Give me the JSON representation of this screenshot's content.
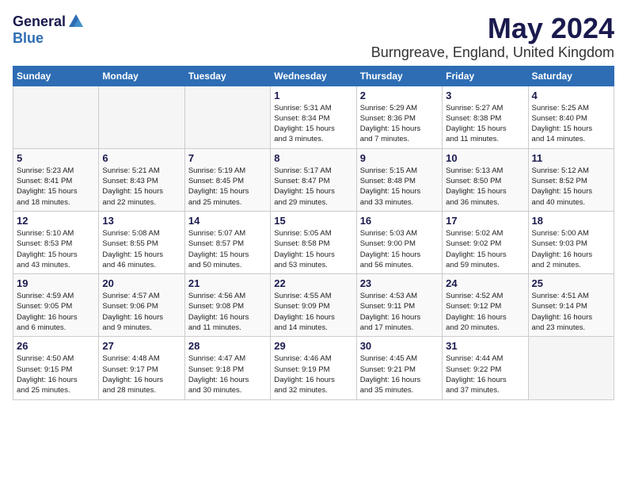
{
  "header": {
    "logo_general": "General",
    "logo_blue": "Blue",
    "title": "May 2024",
    "subtitle": "Burngreave, England, United Kingdom"
  },
  "weekdays": [
    "Sunday",
    "Monday",
    "Tuesday",
    "Wednesday",
    "Thursday",
    "Friday",
    "Saturday"
  ],
  "weeks": [
    [
      {
        "num": "",
        "info": ""
      },
      {
        "num": "",
        "info": ""
      },
      {
        "num": "",
        "info": ""
      },
      {
        "num": "1",
        "info": "Sunrise: 5:31 AM\nSunset: 8:34 PM\nDaylight: 15 hours\nand 3 minutes."
      },
      {
        "num": "2",
        "info": "Sunrise: 5:29 AM\nSunset: 8:36 PM\nDaylight: 15 hours\nand 7 minutes."
      },
      {
        "num": "3",
        "info": "Sunrise: 5:27 AM\nSunset: 8:38 PM\nDaylight: 15 hours\nand 11 minutes."
      },
      {
        "num": "4",
        "info": "Sunrise: 5:25 AM\nSunset: 8:40 PM\nDaylight: 15 hours\nand 14 minutes."
      }
    ],
    [
      {
        "num": "5",
        "info": "Sunrise: 5:23 AM\nSunset: 8:41 PM\nDaylight: 15 hours\nand 18 minutes."
      },
      {
        "num": "6",
        "info": "Sunrise: 5:21 AM\nSunset: 8:43 PM\nDaylight: 15 hours\nand 22 minutes."
      },
      {
        "num": "7",
        "info": "Sunrise: 5:19 AM\nSunset: 8:45 PM\nDaylight: 15 hours\nand 25 minutes."
      },
      {
        "num": "8",
        "info": "Sunrise: 5:17 AM\nSunset: 8:47 PM\nDaylight: 15 hours\nand 29 minutes."
      },
      {
        "num": "9",
        "info": "Sunrise: 5:15 AM\nSunset: 8:48 PM\nDaylight: 15 hours\nand 33 minutes."
      },
      {
        "num": "10",
        "info": "Sunrise: 5:13 AM\nSunset: 8:50 PM\nDaylight: 15 hours\nand 36 minutes."
      },
      {
        "num": "11",
        "info": "Sunrise: 5:12 AM\nSunset: 8:52 PM\nDaylight: 15 hours\nand 40 minutes."
      }
    ],
    [
      {
        "num": "12",
        "info": "Sunrise: 5:10 AM\nSunset: 8:53 PM\nDaylight: 15 hours\nand 43 minutes."
      },
      {
        "num": "13",
        "info": "Sunrise: 5:08 AM\nSunset: 8:55 PM\nDaylight: 15 hours\nand 46 minutes."
      },
      {
        "num": "14",
        "info": "Sunrise: 5:07 AM\nSunset: 8:57 PM\nDaylight: 15 hours\nand 50 minutes."
      },
      {
        "num": "15",
        "info": "Sunrise: 5:05 AM\nSunset: 8:58 PM\nDaylight: 15 hours\nand 53 minutes."
      },
      {
        "num": "16",
        "info": "Sunrise: 5:03 AM\nSunset: 9:00 PM\nDaylight: 15 hours\nand 56 minutes."
      },
      {
        "num": "17",
        "info": "Sunrise: 5:02 AM\nSunset: 9:02 PM\nDaylight: 15 hours\nand 59 minutes."
      },
      {
        "num": "18",
        "info": "Sunrise: 5:00 AM\nSunset: 9:03 PM\nDaylight: 16 hours\nand 2 minutes."
      }
    ],
    [
      {
        "num": "19",
        "info": "Sunrise: 4:59 AM\nSunset: 9:05 PM\nDaylight: 16 hours\nand 6 minutes."
      },
      {
        "num": "20",
        "info": "Sunrise: 4:57 AM\nSunset: 9:06 PM\nDaylight: 16 hours\nand 9 minutes."
      },
      {
        "num": "21",
        "info": "Sunrise: 4:56 AM\nSunset: 9:08 PM\nDaylight: 16 hours\nand 11 minutes."
      },
      {
        "num": "22",
        "info": "Sunrise: 4:55 AM\nSunset: 9:09 PM\nDaylight: 16 hours\nand 14 minutes."
      },
      {
        "num": "23",
        "info": "Sunrise: 4:53 AM\nSunset: 9:11 PM\nDaylight: 16 hours\nand 17 minutes."
      },
      {
        "num": "24",
        "info": "Sunrise: 4:52 AM\nSunset: 9:12 PM\nDaylight: 16 hours\nand 20 minutes."
      },
      {
        "num": "25",
        "info": "Sunrise: 4:51 AM\nSunset: 9:14 PM\nDaylight: 16 hours\nand 23 minutes."
      }
    ],
    [
      {
        "num": "26",
        "info": "Sunrise: 4:50 AM\nSunset: 9:15 PM\nDaylight: 16 hours\nand 25 minutes."
      },
      {
        "num": "27",
        "info": "Sunrise: 4:48 AM\nSunset: 9:17 PM\nDaylight: 16 hours\nand 28 minutes."
      },
      {
        "num": "28",
        "info": "Sunrise: 4:47 AM\nSunset: 9:18 PM\nDaylight: 16 hours\nand 30 minutes."
      },
      {
        "num": "29",
        "info": "Sunrise: 4:46 AM\nSunset: 9:19 PM\nDaylight: 16 hours\nand 32 minutes."
      },
      {
        "num": "30",
        "info": "Sunrise: 4:45 AM\nSunset: 9:21 PM\nDaylight: 16 hours\nand 35 minutes."
      },
      {
        "num": "31",
        "info": "Sunrise: 4:44 AM\nSunset: 9:22 PM\nDaylight: 16 hours\nand 37 minutes."
      },
      {
        "num": "",
        "info": ""
      }
    ]
  ]
}
